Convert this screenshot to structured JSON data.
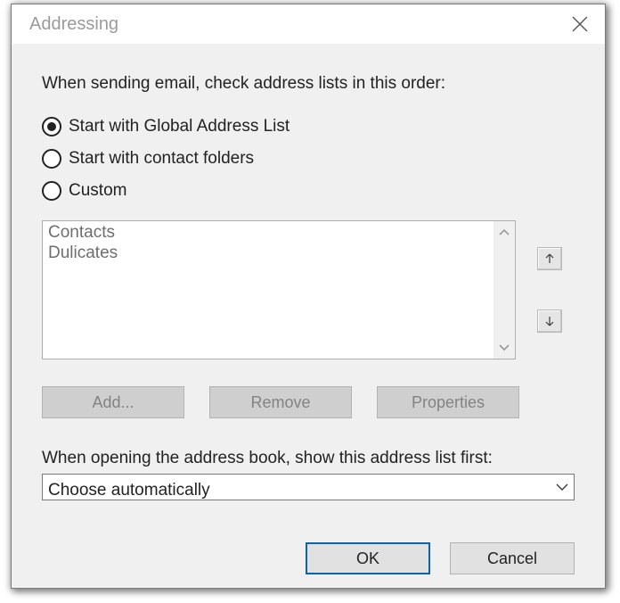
{
  "dialog": {
    "title": "Addressing"
  },
  "instruction": "When sending email, check address lists in this order:",
  "radios": {
    "gal": "Start with Global Address List",
    "contacts": "Start with contact folders",
    "custom": "Custom"
  },
  "list": {
    "items": [
      "Contacts",
      "Dulicates"
    ]
  },
  "buttons": {
    "add": "Add...",
    "remove": "Remove",
    "properties": "Properties"
  },
  "open_label": "When opening the address book, show this address list first:",
  "dropdown": {
    "selected": "Choose automatically"
  },
  "footer": {
    "ok": "OK",
    "cancel": "Cancel"
  }
}
